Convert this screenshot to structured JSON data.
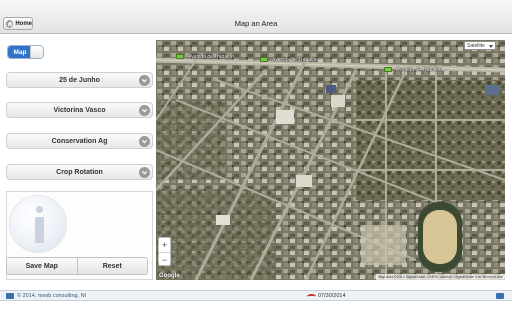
{
  "header": {
    "home_label": "Home",
    "title": "Map an Area"
  },
  "sidebar": {
    "toggle_label": "Map",
    "dropdowns": [
      {
        "label": "25 de Junho"
      },
      {
        "label": "Victorina Vasco"
      },
      {
        "label": "Conservation Ag"
      },
      {
        "label": "Crop Rotation"
      }
    ],
    "save_label": "Save Map",
    "reset_label": "Reset"
  },
  "map": {
    "type_selector": "Satellite",
    "zoom_in": "+",
    "zoom_out": "−",
    "road_labels": [
      "Avenida de Trabalho",
      "Avenida de Trabalho",
      "Avenida de Trabalho"
    ],
    "google_logo": "Google",
    "attribution": "Map data ©2014 DigitalGlobe, CNES / Astrium, DigitalGlobe   5 m   Terms of Use"
  },
  "footer": {
    "copyright": "© 2014, mesb consulting, NI",
    "date": "07/30/2014"
  },
  "colors": {
    "toggle_blue": "#2f74c8",
    "road_badge": "#7ac943",
    "footer_text": "#345a85"
  },
  "icons": [
    "home-icon",
    "chevron-down-icon",
    "info-icon",
    "app-logo-icon",
    "calendar-icon"
  ]
}
